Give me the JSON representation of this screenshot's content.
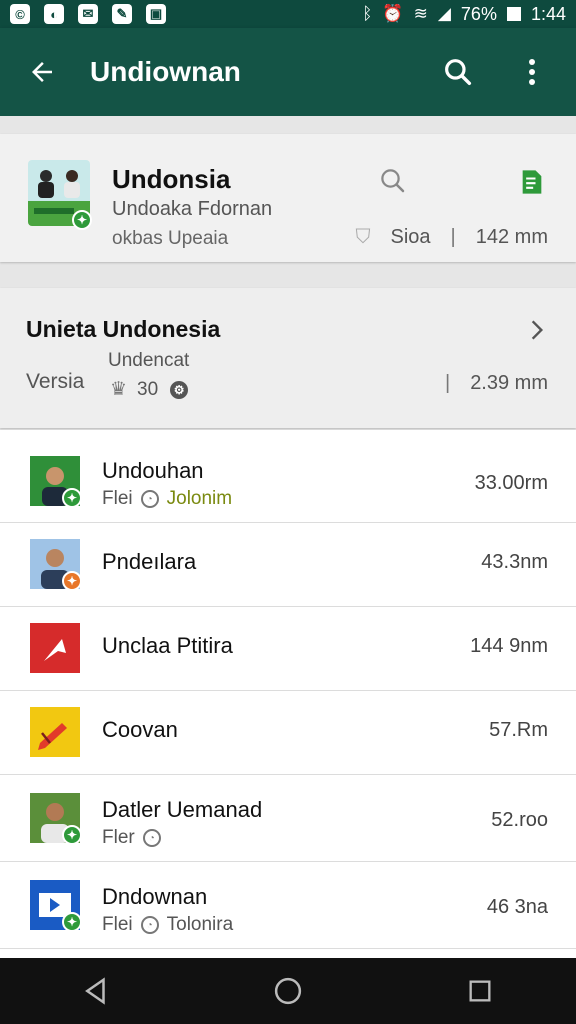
{
  "status_bar": {
    "battery_text": "76%",
    "time": "1:44"
  },
  "app_bar": {
    "title": "Undiownan"
  },
  "header_card": {
    "title": "Undonsia",
    "subtitle": "Undoaka Fdornan",
    "subtitle2": "okbas Upeaia",
    "meta_label": "Sioa",
    "size": "142 mm"
  },
  "section_card": {
    "title": "Unieta Undonesia",
    "subtitle": "Undencat",
    "version_label": "Versia",
    "version_count": "30",
    "size": "2.39 mm"
  },
  "list": [
    {
      "title": "Undouhan",
      "sub_prefix": "Flei",
      "sub_label": "Jolonim",
      "size": "33.00rm",
      "badge_color": "#2e9a3a"
    },
    {
      "title": "Pndeılara",
      "sub_prefix": "",
      "sub_label": "",
      "size": "43.3nm",
      "badge_color": "#e8772a"
    },
    {
      "title": "Unclaa Ptitira",
      "sub_prefix": "",
      "sub_label": "",
      "size": "144 9nm",
      "badge_color": ""
    },
    {
      "title": "Coovan",
      "sub_prefix": "",
      "sub_label": "",
      "size": "57.Rm",
      "badge_color": ""
    },
    {
      "title": "Datler Uemanad",
      "sub_prefix": "Fler",
      "sub_label": "",
      "size": "52.roo",
      "badge_color": "#2e9a3a"
    },
    {
      "title": "Dndownan",
      "sub_prefix": "Flei",
      "sub_label": "Tolonira",
      "size": "46 3na",
      "badge_color": "#2e9a3a"
    }
  ],
  "colors": {
    "primary": "#145446",
    "status_bar": "#0e4a3e",
    "accent_green": "#2e9a3a",
    "accent_orange": "#e8772a",
    "sub_highlight": "#7a8a10"
  },
  "icons": {
    "back": "arrow-left-icon",
    "search": "search-icon",
    "more": "more-vert-icon",
    "doc": "document-icon",
    "chevron": "chevron-right-icon"
  }
}
